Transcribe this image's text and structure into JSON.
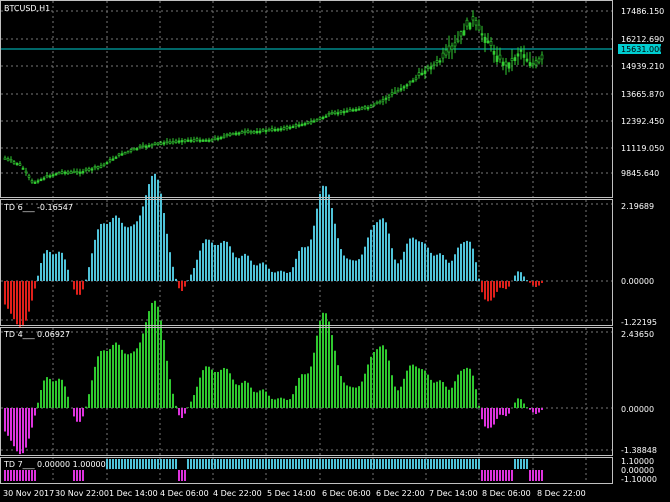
{
  "main": {
    "symbol_label": "BTCUSD,H1",
    "price_ticks": [
      "17486.150",
      "16212.690",
      "14939.210",
      "13665.870",
      "12392.450",
      "11119.050",
      "9845.640"
    ],
    "current_price": "15631.000",
    "colors": {
      "candles": "#32cd32",
      "grid": "#c0c0c0",
      "price_line": "#00ced1",
      "badge": "#00ced1"
    }
  },
  "td6": {
    "label": "TD 6___",
    "value": "-0.16547",
    "ticks": [
      "2.19689",
      "0.00000",
      "-1.22195"
    ],
    "colors": {
      "positive": "#4fc3d9",
      "negative": "#e0201b"
    }
  },
  "td4": {
    "label": "TD 4___",
    "value": "0.06927",
    "ticks": [
      "2.43650",
      "0.00000",
      "-1.38848"
    ],
    "colors": {
      "positive": "#2fc82f",
      "negative": "#dd33dd"
    }
  },
  "td7": {
    "label": "TD 7___",
    "value": "0.00000 1.00000",
    "ticks": [
      "1.10000",
      "0.00000",
      "-1.10000"
    ],
    "colors": {
      "positive": "#4fc3d9",
      "negative": "#dd33dd"
    }
  },
  "time_axis": [
    "30 Nov 2017",
    "30 Nov 22:00",
    "1 Dec 14:00",
    "4 Dec 06:00",
    "4 Dec 22:00",
    "5 Dec 14:00",
    "6 Dec 06:00",
    "6 Dec 22:00",
    "7 Dec 14:00",
    "8 Dec 06:00",
    "8 Dec 22:00"
  ]
}
